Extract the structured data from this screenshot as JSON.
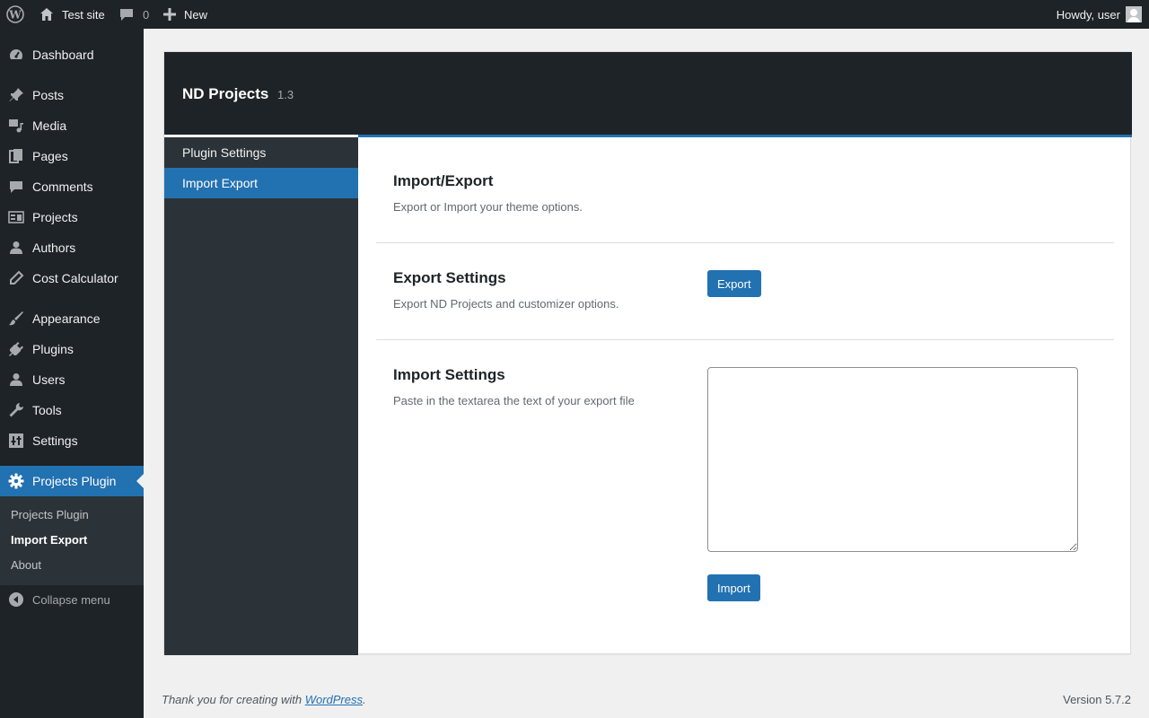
{
  "adminbar": {
    "site_name": "Test site",
    "comments_count": "0",
    "new_label": "New",
    "howdy": "Howdy, user"
  },
  "sidebar": {
    "items": [
      {
        "label": "Dashboard",
        "icon": "dashboard-icon"
      },
      {
        "label": "Posts",
        "icon": "pin-icon"
      },
      {
        "label": "Media",
        "icon": "media-icon"
      },
      {
        "label": "Pages",
        "icon": "pages-icon"
      },
      {
        "label": "Comments",
        "icon": "comment-icon"
      },
      {
        "label": "Projects",
        "icon": "projects-icon"
      },
      {
        "label": "Authors",
        "icon": "user-icon"
      },
      {
        "label": "Cost Calculator",
        "icon": "edit-icon"
      },
      {
        "label": "Appearance",
        "icon": "brush-icon"
      },
      {
        "label": "Plugins",
        "icon": "plugin-icon"
      },
      {
        "label": "Users",
        "icon": "users-icon"
      },
      {
        "label": "Tools",
        "icon": "wrench-icon"
      },
      {
        "label": "Settings",
        "icon": "settings-icon"
      },
      {
        "label": "Projects Plugin",
        "icon": "gear-icon"
      }
    ],
    "submenu": [
      "Projects Plugin",
      "Import Export",
      "About"
    ],
    "collapse_label": "Collapse menu"
  },
  "panel": {
    "title": "ND Projects",
    "version": "1.3",
    "nav": [
      "Plugin Settings",
      "Import Export"
    ],
    "sections": {
      "intro": {
        "title": "Import/Export",
        "desc": "Export or Import your theme options."
      },
      "export": {
        "title": "Export Settings",
        "desc": "Export ND Projects and customizer options.",
        "button": "Export"
      },
      "import": {
        "title": "Import Settings",
        "desc": "Paste in the textarea the text of your export file",
        "button": "Import",
        "textarea_value": ""
      }
    }
  },
  "footer": {
    "thanks_prefix": "Thank you for creating with ",
    "link": "WordPress",
    "thanks_suffix": ".",
    "version": "Version 5.7.2"
  },
  "colors": {
    "accent": "#2271b1",
    "admin_dark": "#1d2327",
    "admin_sub": "#2c3338"
  }
}
